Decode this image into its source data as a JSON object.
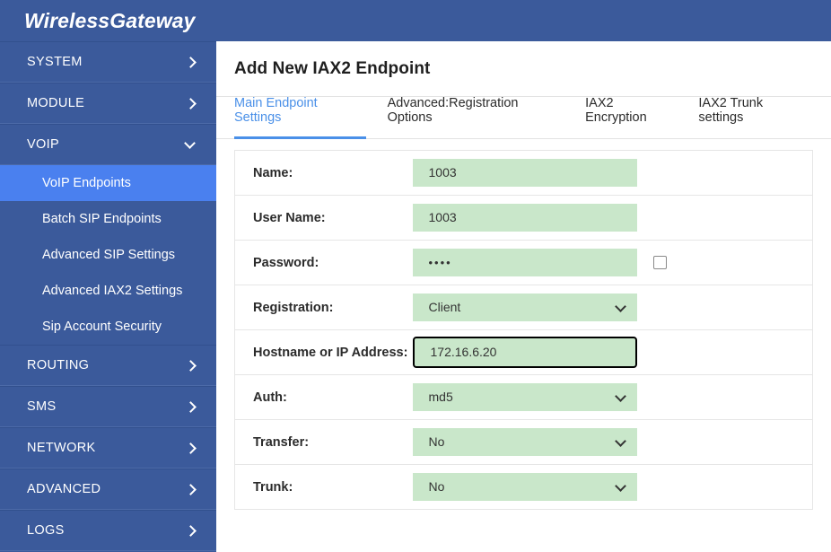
{
  "header": {
    "brand": "WirelessGateway"
  },
  "sidebar": {
    "groups": [
      {
        "label": "SYSTEM",
        "icon": "chevron-right-icon",
        "expanded": false
      },
      {
        "label": "MODULE",
        "icon": "chevron-right-icon",
        "expanded": false
      },
      {
        "label": "VOIP",
        "icon": "chevron-down-icon",
        "expanded": true
      }
    ],
    "voip_items": [
      {
        "label": "VoIP Endpoints",
        "active": true
      },
      {
        "label": "Batch SIP Endpoints",
        "active": false
      },
      {
        "label": "Advanced SIP Settings",
        "active": false
      },
      {
        "label": "Advanced IAX2 Settings",
        "active": false
      },
      {
        "label": "Sip Account Security",
        "active": false
      }
    ],
    "groups_bottom": [
      {
        "label": "ROUTING",
        "icon": "chevron-right-icon"
      },
      {
        "label": "SMS",
        "icon": "chevron-right-icon"
      },
      {
        "label": "NETWORK",
        "icon": "chevron-right-icon"
      },
      {
        "label": "ADVANCED",
        "icon": "chevron-right-icon"
      },
      {
        "label": "LOGS",
        "icon": "chevron-right-icon"
      }
    ]
  },
  "main": {
    "title": "Add New IAX2 Endpoint",
    "tabs": [
      {
        "label": "Main Endpoint Settings",
        "active": true
      },
      {
        "label": "Advanced:Registration Options",
        "active": false
      },
      {
        "label": "IAX2 Encryption",
        "active": false
      },
      {
        "label": "IAX2 Trunk settings",
        "active": false
      }
    ],
    "form": {
      "name": {
        "label": "Name:",
        "value": "1003"
      },
      "user_name": {
        "label": "User Name:",
        "value": "1003"
      },
      "password": {
        "label": "Password:",
        "value": "••••",
        "checkbox_checked": false
      },
      "registration": {
        "label": "Registration:",
        "value": "Client",
        "icon": "chevron-down-icon"
      },
      "hostname": {
        "label": "Hostname or IP Address:",
        "value": "172.16.6.20",
        "focused": true
      },
      "auth": {
        "label": "Auth:",
        "value": "md5",
        "icon": "chevron-down-icon"
      },
      "transfer": {
        "label": "Transfer:",
        "value": "No",
        "icon": "chevron-down-icon"
      },
      "trunk": {
        "label": "Trunk:",
        "value": "No",
        "icon": "chevron-down-icon"
      }
    }
  },
  "colors": {
    "brand_blue": "#3b5a9b",
    "active_nav": "#4a80ef",
    "tab_active": "#4a90e8",
    "field_green": "#c9e7ca"
  }
}
